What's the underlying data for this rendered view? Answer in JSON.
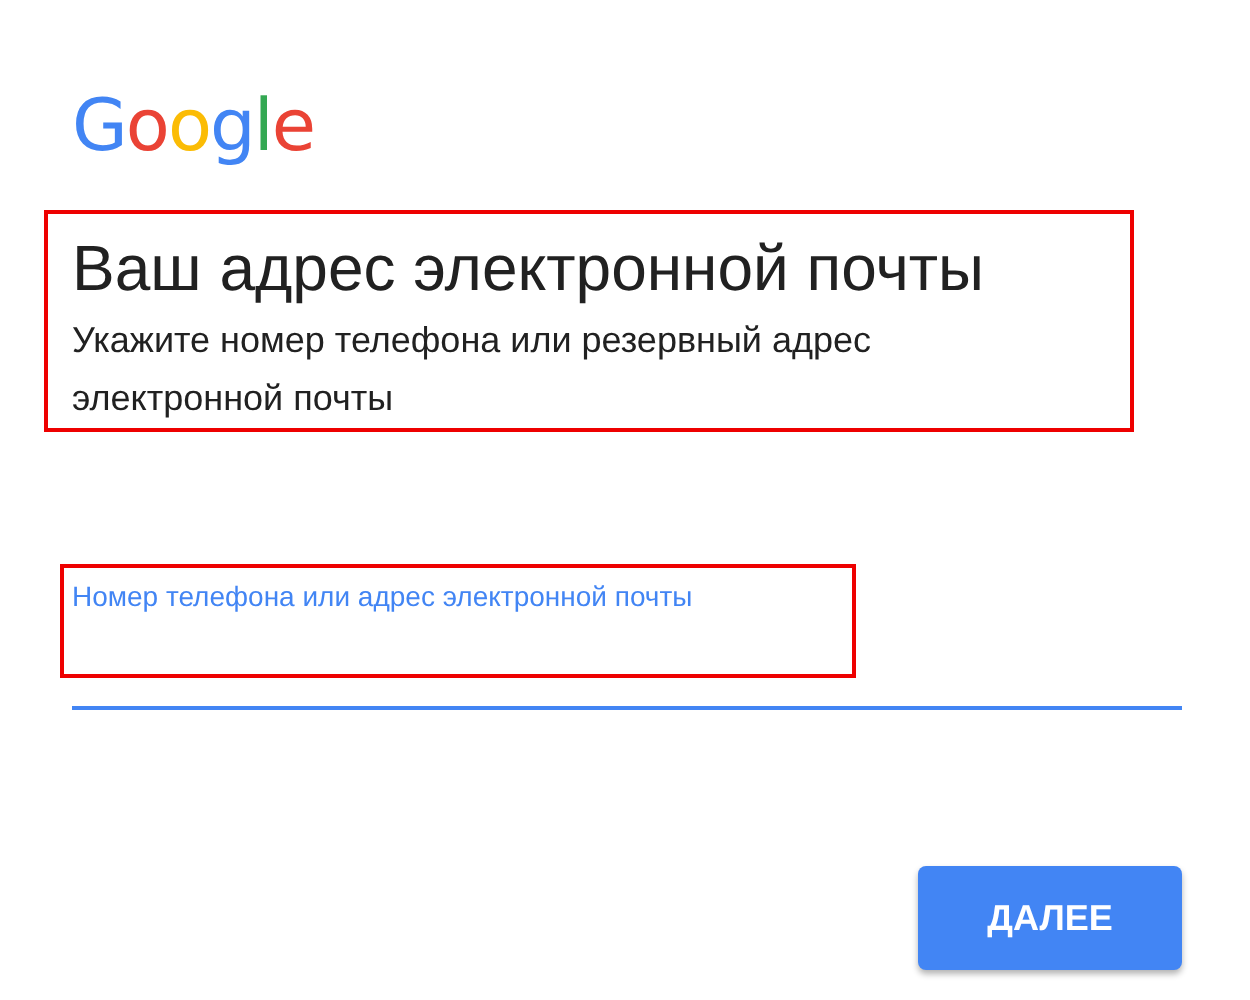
{
  "logo": "Google",
  "heading": "Ваш адрес электронной почты",
  "subtitle": "Укажите номер телефона или резервный адрес электронной почты",
  "field": {
    "label": "Номер телефона или адрес электронной почты",
    "focused": true
  },
  "buttons": [
    "ДАЛЕЕ"
  ]
}
